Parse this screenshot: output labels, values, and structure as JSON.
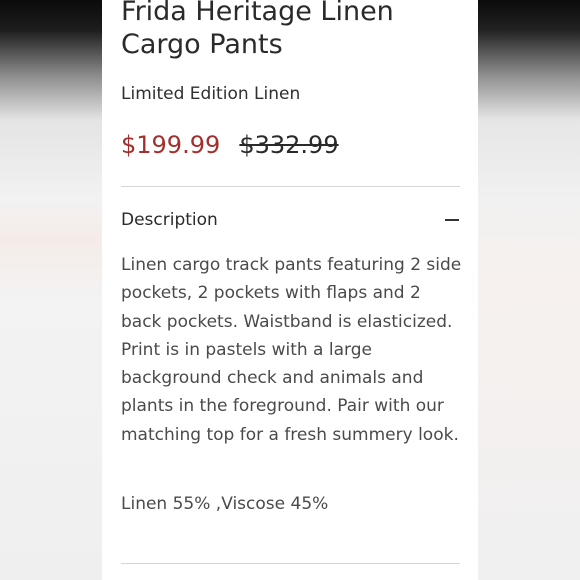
{
  "product": {
    "title": "Frida Heritage Linen Cargo Pants",
    "subtitle": "Limited Edition Linen",
    "price_sale": "$199.99",
    "price_original": "$332.99"
  },
  "description": {
    "header": "Description",
    "toggle_icon": "minus-icon",
    "text": "Linen cargo track pants featuring 2 side pockets, 2 pockets with flaps and 2 back pockets. Waistband is elasticized. Print is in pastels with a large background check and animals and plants in the foreground. Pair with our matching top for a fresh summery look.",
    "composition": "Linen 55% ,Viscose 45%"
  },
  "colors": {
    "sale_price": "#a3302c",
    "text": "#2a2a2a",
    "divider": "#d6d6d6"
  }
}
